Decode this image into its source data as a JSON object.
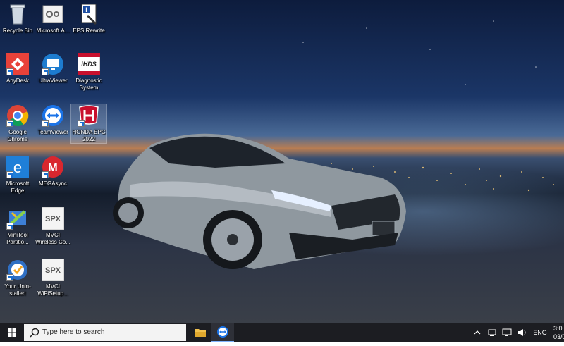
{
  "desktop": {
    "icons": [
      {
        "label": "Recycle Bin"
      },
      {
        "label": "Microsoft.A..."
      },
      {
        "label": "EPS Rewrite"
      },
      {
        "label": "AnyDesk"
      },
      {
        "label": "UltraViewer"
      },
      {
        "label": "Diagnostic System"
      },
      {
        "label": "Google Chrome"
      },
      {
        "label": "TeamViewer"
      },
      {
        "label": "HONDA EPC 2022"
      },
      {
        "label": "Microsoft Edge"
      },
      {
        "label": "MEGAsync"
      },
      {
        "label": "MiniTool Partitio..."
      },
      {
        "label": "MVCI Wireless Co..."
      },
      {
        "label": "Your Unin-staller!"
      },
      {
        "label": "MVCI WiFiSetup..."
      }
    ],
    "icon_text": {
      "hds": "iHDS",
      "spx": "SPX"
    }
  },
  "taskbar": {
    "search_placeholder": "Type here to search",
    "language": "ENG",
    "clock_time": "3:0",
    "clock_date": "03/0"
  },
  "colors": {
    "taskbar": "#1c1d22",
    "anydesk": "#e8423a",
    "teamviewer": "#1a73e8",
    "mega": "#d9272e",
    "honda": "#c8102e"
  }
}
